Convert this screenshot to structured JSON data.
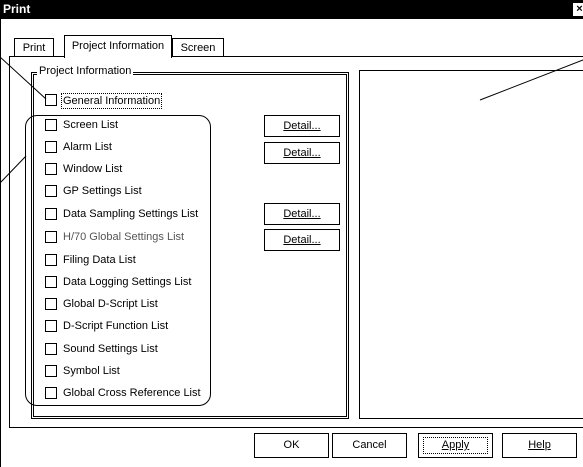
{
  "window": {
    "title": "Print",
    "close_glyph": "×"
  },
  "tabs": [
    {
      "label": "Print",
      "active": false
    },
    {
      "label": "Project Information",
      "active": true
    },
    {
      "label": "Screen",
      "active": false
    }
  ],
  "group": {
    "label": "Project Information"
  },
  "items": [
    {
      "label": "General Information",
      "checked": false
    },
    {
      "label": "Screen List",
      "checked": false
    },
    {
      "label": "Alarm List",
      "checked": false
    },
    {
      "label": "Window List",
      "checked": false
    },
    {
      "label": "GP Settings List",
      "checked": false
    },
    {
      "label": "Data Sampling Settings List",
      "checked": false
    },
    {
      "label": "H/70 Global Settings List",
      "checked": false,
      "disabled": true
    },
    {
      "label": "Filing Data List",
      "checked": false
    },
    {
      "label": "Data Logging Settings List",
      "checked": false
    },
    {
      "label": "Global D-Script List",
      "checked": false
    },
    {
      "label": "D-Script Function List",
      "checked": false
    },
    {
      "label": "Sound Settings List",
      "checked": false
    },
    {
      "label": "Symbol List",
      "checked": false
    },
    {
      "label": "Global Cross Reference List",
      "checked": false
    }
  ],
  "detail_buttons": [
    "Detail...",
    "Detail...",
    "Detail...",
    "Detail..."
  ],
  "buttons": {
    "ok": "OK",
    "cancel": "Cancel",
    "apply": "Apply",
    "help": "Help"
  }
}
